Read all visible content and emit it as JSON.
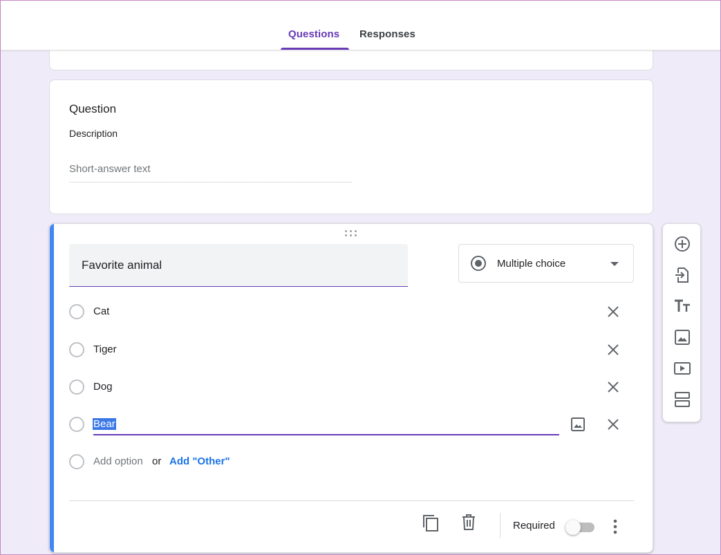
{
  "tabs": [
    {
      "label": "Questions",
      "active": true
    },
    {
      "label": "Responses",
      "active": false
    }
  ],
  "short_answer_card": {
    "title": "Question",
    "description": "Description",
    "answer_placeholder": "Short-answer text"
  },
  "active_question": {
    "title": "Favorite animal",
    "type_label": "Multiple choice",
    "options": [
      {
        "label": "Cat"
      },
      {
        "label": "Tiger"
      },
      {
        "label": "Dog"
      },
      {
        "label": "Bear"
      }
    ],
    "add_option_label": "Add option",
    "or_label": "or",
    "add_other_label": "Add \"Other\"",
    "required_label": "Required",
    "required": false
  },
  "toolbar": {
    "icons": [
      "add-question-icon",
      "import-questions-icon",
      "add-title-icon",
      "add-image-icon",
      "add-video-icon",
      "add-section-icon"
    ]
  },
  "colors": {
    "accent": "#673ab7",
    "active_bar": "#4285f4",
    "background": "#f0ebf8",
    "link": "#1a73e8"
  }
}
